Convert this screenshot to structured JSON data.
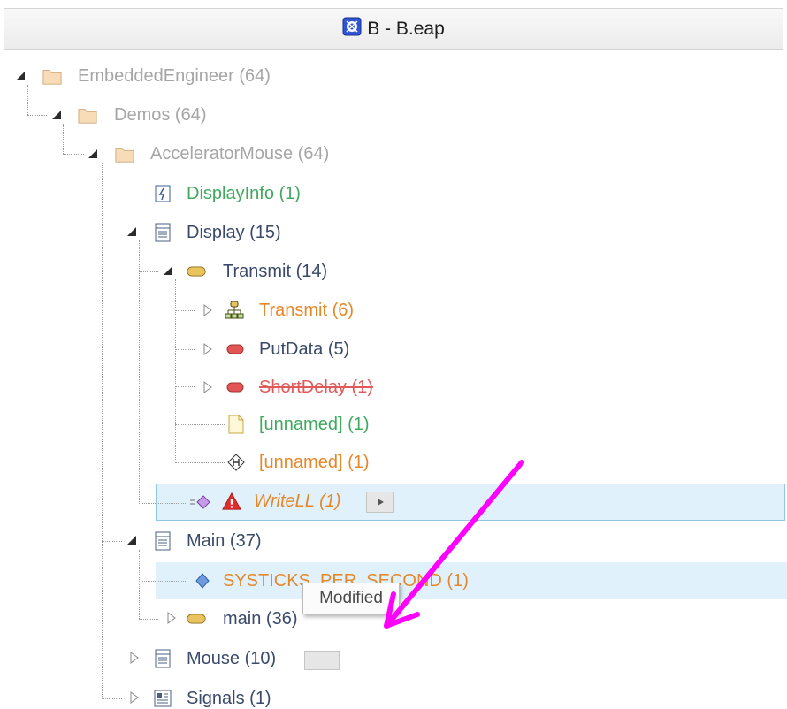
{
  "window": {
    "title": "B - B.eap",
    "title_icon": "package-model-icon"
  },
  "tree": {
    "nodes": [
      {
        "label": "EmbeddedEngineer (64)",
        "icon": "folder-icon",
        "state": "expanded",
        "style": "gray"
      },
      {
        "label": "Demos (64)",
        "icon": "folder-icon",
        "state": "expanded",
        "style": "gray"
      },
      {
        "label": "AcceleratorMouse (64)",
        "icon": "folder-icon",
        "state": "expanded",
        "style": "gray"
      },
      {
        "label": "DisplayInfo (1)",
        "icon": "info-element-icon",
        "state": "leaf",
        "style": "green"
      },
      {
        "label": "Display (15)",
        "icon": "class-icon",
        "state": "expanded",
        "style": "dark"
      },
      {
        "label": "Transmit (14)",
        "icon": "activity-icon",
        "state": "expanded",
        "style": "dark"
      },
      {
        "label": "Transmit (6)",
        "icon": "activity-diagram-icon",
        "state": "collapsed",
        "style": "orange"
      },
      {
        "label": "PutData (5)",
        "icon": "action-icon",
        "state": "collapsed",
        "style": "dark"
      },
      {
        "label": "ShortDelay (1)",
        "icon": "action-icon",
        "state": "collapsed",
        "style": "deleted"
      },
      {
        "label": "[unnamed] (1)",
        "icon": "note-icon",
        "state": "leaf",
        "style": "green"
      },
      {
        "label": "[unnamed] (1)",
        "icon": "history-node-icon",
        "state": "leaf",
        "style": "orange"
      },
      {
        "label": "WriteLL (1)",
        "icon": "operation-icon",
        "state": "leaf",
        "style": "italic-orange",
        "warning": true,
        "selected": true
      },
      {
        "label": "Main (37)",
        "icon": "class-icon",
        "state": "expanded",
        "style": "dark"
      },
      {
        "label": "SYSTICKS_PER_SECOND (1)",
        "icon": "attribute-icon",
        "state": "leaf",
        "style": "orange",
        "highlighted": true
      },
      {
        "label": "main (36)",
        "icon": "activity-icon",
        "state": "collapsed",
        "style": "dark"
      },
      {
        "label": "Mouse (10)",
        "icon": "class-icon",
        "state": "collapsed",
        "style": "dark"
      },
      {
        "label": "Signals (1)",
        "icon": "signal-class-icon",
        "state": "collapsed",
        "style": "dark"
      }
    ]
  },
  "tooltip": {
    "text": "Modified"
  },
  "annotation": {
    "color": "#ff00ff"
  },
  "colors": {
    "gray": "#a6a6a6",
    "dark": "#3a4a6b",
    "green": "#3fa95e",
    "orange": "#e5882a",
    "red": "#e05a5a",
    "highlight": "#e1f1fb"
  }
}
